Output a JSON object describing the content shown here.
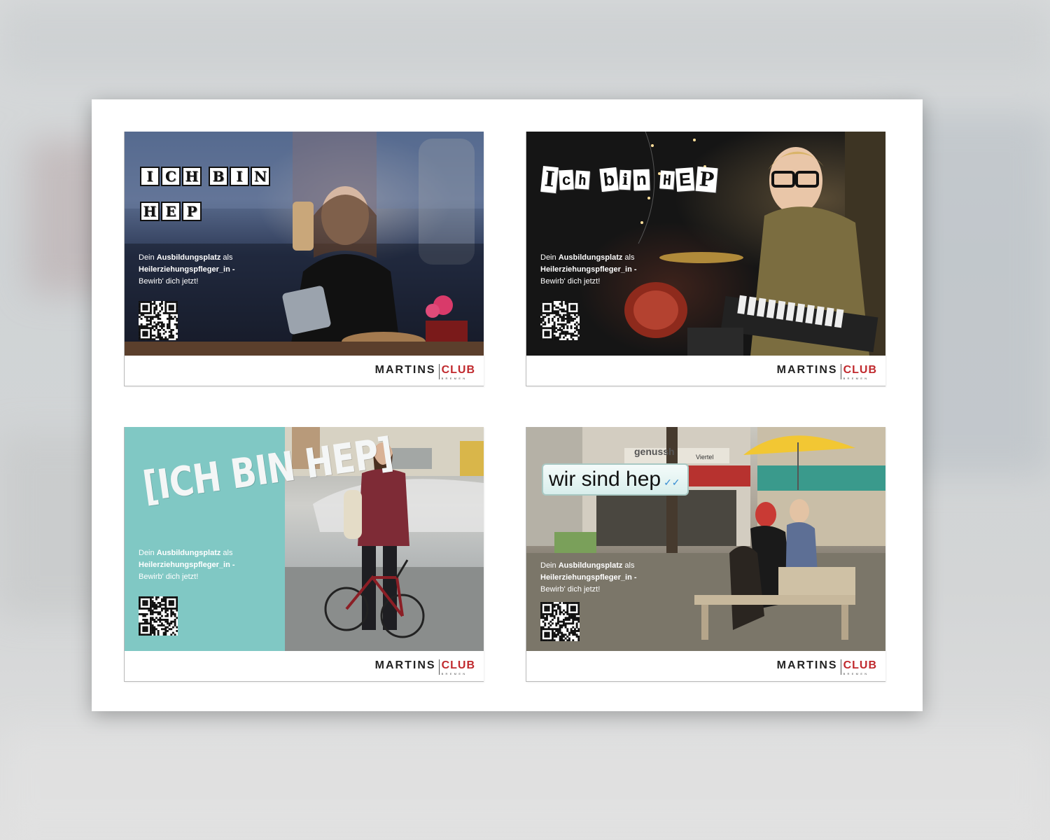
{
  "cards": [
    {
      "headline": "ICH BIN HEP",
      "tagline_1a": "Dein ",
      "tagline_1b": "Ausbildungsplatz",
      "tagline_1c": " als",
      "tagline_2": "Heilerziehungspfleger_in -",
      "tagline_3": "Bewirb' dich jetzt!",
      "logo_left": "MARTINS",
      "logo_right": "CLUB",
      "logo_sub": "BREMEN"
    },
    {
      "headline": "Ich bin HEP",
      "tagline_1a": "Dein ",
      "tagline_1b": "Ausbildungsplatz",
      "tagline_1c": " als",
      "tagline_2": "Heilerziehungspfleger_in -",
      "tagline_3": "Bewirb' dich jetzt!",
      "logo_left": "MARTINS",
      "logo_right": "CLUB",
      "logo_sub": "BREMEN"
    },
    {
      "headline": "[ICH BIN HEP]",
      "tagline_1a": "Dein ",
      "tagline_1b": "Ausbildungsplatz",
      "tagline_1c": " als",
      "tagline_2": "Heilerziehungspfleger_in -",
      "tagline_3": "Bewirb' dich jetzt!",
      "logo_left": "MARTINS",
      "logo_right": "CLUB",
      "logo_sub": "BREMEN"
    },
    {
      "headline": "wir sind hep",
      "tagline_1a": "Dein ",
      "tagline_1b": "Ausbildungsplatz",
      "tagline_1c": " als",
      "tagline_2": "Heilerziehungspfleger_in -",
      "tagline_3": "Bewirb' dich jetzt!",
      "logo_left": "MARTINS",
      "logo_right": "CLUB",
      "logo_sub": "BREMEN",
      "shop_sign": "genussh",
      "shop_sign_2": "Viertel"
    }
  ],
  "colors": {
    "brand_red": "#c0292d",
    "teal_panel": "#80c8c4",
    "umbrella_yellow": "#f2c733"
  }
}
